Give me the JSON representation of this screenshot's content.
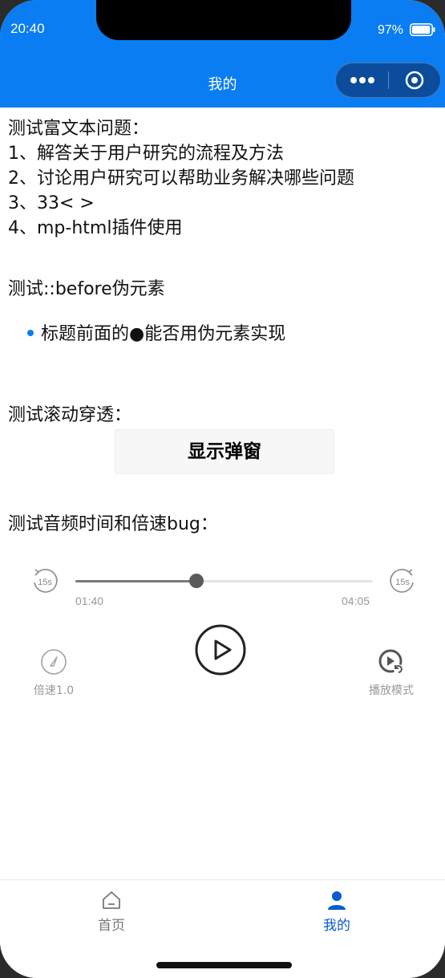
{
  "status_bar": {
    "time": "20:40",
    "battery": "97%",
    "battery_level": 0.97
  },
  "nav": {
    "title": "我的"
  },
  "colors": {
    "primary": "#0a7df2",
    "tab_active": "#0a5ccf",
    "tab_inactive": "#777777"
  },
  "content": {
    "rich_text_title": "测试富文本问题：",
    "rich_text_items": [
      "1、解答关于用户研究的流程及方法",
      "2、讨论用户研究可以帮助业务解决哪些问题",
      "3、33< >",
      "4、mp-html插件使用"
    ],
    "before_title": "测试::before伪元素",
    "before_item": "标题前面的●能否用伪元素实现",
    "scroll_title": "测试滚动穿透：",
    "popup_button": "显示弹窗",
    "audio_title": "测试音频时间和倍速bug："
  },
  "player": {
    "current_time": "01:40",
    "total_time": "04:05",
    "progress": 0.408,
    "skip_back_label": "15s",
    "skip_forward_label": "15s",
    "speed_label": "倍速1.0",
    "mode_label": "播放模式",
    "icons": {
      "rewind": "rewind-15s-icon",
      "forward": "forward-15s-icon",
      "play": "play-icon",
      "speed": "speed-gauge-icon",
      "mode": "play-mode-icon"
    }
  },
  "tabbar": {
    "tabs": [
      {
        "label": "首页",
        "icon": "home-icon",
        "active": false
      },
      {
        "label": "我的",
        "icon": "user-icon",
        "active": true
      }
    ]
  }
}
